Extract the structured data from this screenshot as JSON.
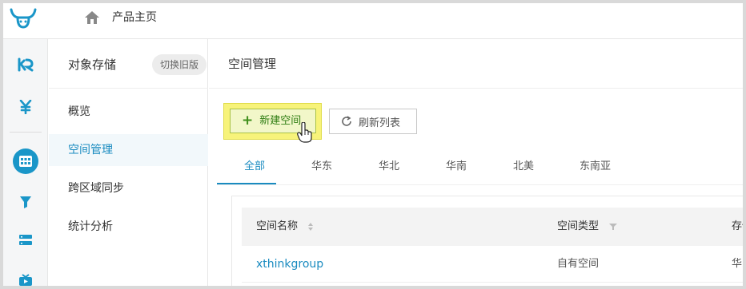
{
  "header": {
    "logo_icon": "bull-logo-icon",
    "home_icon": "home-icon",
    "title": "产品主页"
  },
  "rail": {
    "items": [
      {
        "icon": "ke-logo-icon"
      },
      {
        "icon": "yen-icon"
      },
      {
        "icon": "storage-grid-icon",
        "active": true
      },
      {
        "icon": "funnel-icon"
      },
      {
        "icon": "server-list-icon"
      },
      {
        "icon": "tv-icon"
      }
    ],
    "accent": "#1a96c8"
  },
  "submenu": {
    "title": "对象存储",
    "switch_label": "切换旧版",
    "items": [
      {
        "label": "概览",
        "active": false
      },
      {
        "label": "空间管理",
        "active": true
      },
      {
        "label": "跨区域同步",
        "active": false
      },
      {
        "label": "统计分析",
        "active": false
      }
    ]
  },
  "main": {
    "title": "空间管理",
    "create_label": "新建空间",
    "refresh_label": "刷新列表",
    "tabs": [
      {
        "label": "全部",
        "active": true
      },
      {
        "label": "华东",
        "active": false
      },
      {
        "label": "华北",
        "active": false
      },
      {
        "label": "华南",
        "active": false
      },
      {
        "label": "北美",
        "active": false
      },
      {
        "label": "东南亚",
        "active": false
      }
    ],
    "table": {
      "columns": [
        "空间名称",
        "空间类型",
        "存储"
      ],
      "rows": [
        {
          "name": "xthinkgroup",
          "type": "自有空间",
          "region": "华东"
        }
      ]
    }
  },
  "colors": {
    "accent": "#1a8bc0",
    "create_highlight": "#f7f37a",
    "create_text": "#2e7d12"
  }
}
